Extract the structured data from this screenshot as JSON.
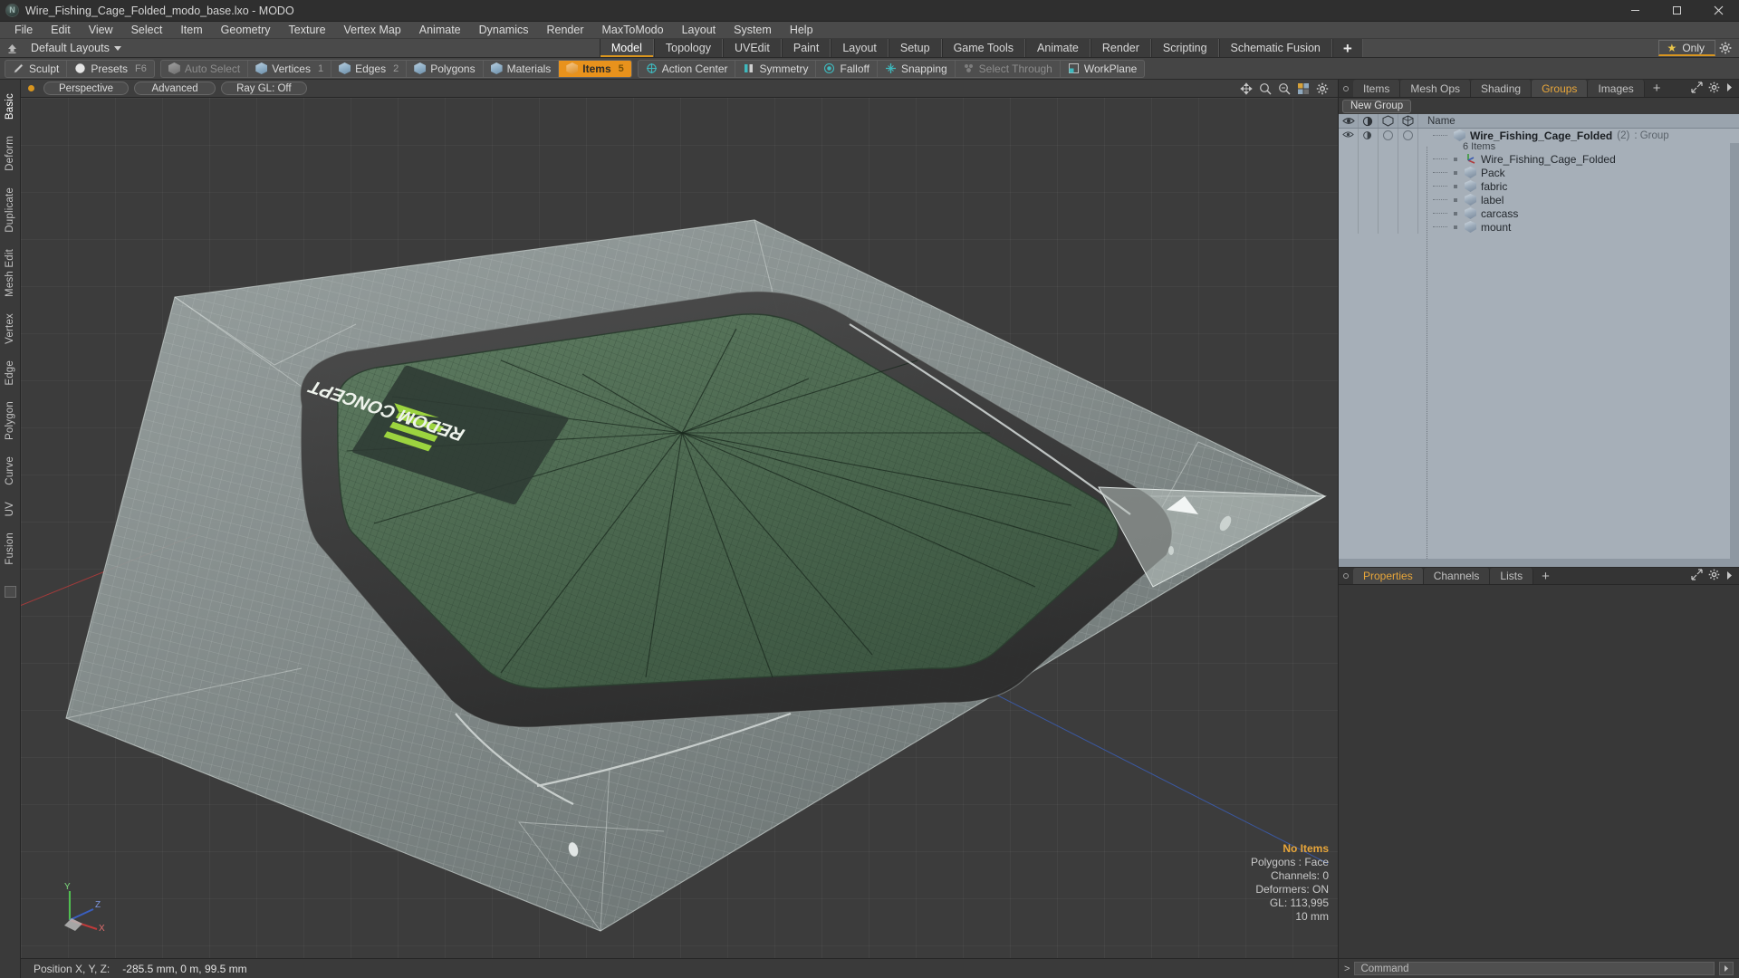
{
  "window": {
    "title": "Wire_Fishing_Cage_Folded_modo_base.lxo - MODO",
    "app_icon": "modo-logo-icon",
    "minimize": "minimize-icon",
    "maximize": "maximize-icon",
    "close": "close-icon"
  },
  "menubar": {
    "items": [
      "File",
      "Edit",
      "View",
      "Select",
      "Item",
      "Geometry",
      "Texture",
      "Vertex Map",
      "Animate",
      "Dynamics",
      "Render",
      "MaxToModo",
      "Layout",
      "System",
      "Help"
    ]
  },
  "layoutrow": {
    "home_icon": "home-icon",
    "layout_selector": "Default Layouts",
    "tabs": [
      {
        "label": "Model",
        "active": true
      },
      {
        "label": "Topology",
        "active": false
      },
      {
        "label": "UVEdit",
        "active": false
      },
      {
        "label": "Paint",
        "active": false
      },
      {
        "label": "Layout",
        "active": false
      },
      {
        "label": "Setup",
        "active": false
      },
      {
        "label": "Game Tools",
        "active": false
      },
      {
        "label": "Animate",
        "active": false
      },
      {
        "label": "Render",
        "active": false
      },
      {
        "label": "Scripting",
        "active": false
      },
      {
        "label": "Schematic Fusion",
        "active": false
      }
    ],
    "add_tab": "+",
    "only_button": "Only",
    "star_icon": "star-icon",
    "gear_icon": "gear-icon"
  },
  "modebar": {
    "group1": [
      {
        "label": "Sculpt",
        "icon": "pen-icon",
        "state": "normal",
        "badge": ""
      },
      {
        "label": "Presets",
        "icon": "sphere-icon",
        "state": "normal",
        "badge": "F6"
      }
    ],
    "group2": [
      {
        "label": "Auto Select",
        "icon": "cube-grey-icon",
        "state": "disabled",
        "badge": ""
      },
      {
        "label": "Vertices",
        "icon": "cube-icon",
        "state": "normal",
        "badge": "1"
      },
      {
        "label": "Edges",
        "icon": "cube-icon",
        "state": "normal",
        "badge": "2"
      },
      {
        "label": "Polygons",
        "icon": "cube-icon",
        "state": "normal",
        "badge": ""
      },
      {
        "label": "Materials",
        "icon": "cube-icon",
        "state": "normal",
        "badge": ""
      },
      {
        "label": "Items",
        "icon": "cube-orange-icon",
        "state": "selected",
        "badge": "5"
      }
    ],
    "group3": [
      {
        "label": "Action Center",
        "icon": "target-icon",
        "state": "normal",
        "badge": ""
      },
      {
        "label": "Symmetry",
        "icon": "symmetry-icon",
        "state": "normal",
        "badge": ""
      },
      {
        "label": "Falloff",
        "icon": "falloff-icon",
        "state": "normal",
        "badge": ""
      },
      {
        "label": "Snapping",
        "icon": "snap-icon",
        "state": "normal",
        "badge": ""
      },
      {
        "label": "Select Through",
        "icon": "select-through-icon",
        "state": "disabled",
        "badge": ""
      },
      {
        "label": "WorkPlane",
        "icon": "workplane-icon",
        "state": "normal",
        "badge": ""
      }
    ]
  },
  "left_strip": {
    "tabs": [
      "Basic",
      "Deform",
      "Duplicate",
      "Mesh Edit",
      "Vertex",
      "Edge",
      "Polygon",
      "Curve",
      "UV",
      "Fusion"
    ]
  },
  "viewport": {
    "header": {
      "dot": "active-dot-icon",
      "view_mode": "Perspective",
      "shading": "Advanced",
      "raygl": "Ray GL: Off",
      "icons": [
        "move-icon",
        "zoom-icon",
        "search-icon",
        "view-options-icon",
        "gear-icon"
      ]
    },
    "overlay": {
      "selection": "No Items",
      "polygons": "Polygons : Face",
      "channels": "Channels: 0",
      "deformers": "Deformers: ON",
      "gl": "GL: 113,995",
      "scale": "10 mm"
    },
    "gizmo_labels": {
      "y": "Y",
      "x": "X",
      "z": "Z"
    }
  },
  "statusbar": {
    "label": "Position X, Y, Z:",
    "value": "-285.5 mm, 0 m, 99.5 mm"
  },
  "right_panel": {
    "tabs": [
      {
        "label": "Items",
        "active": false
      },
      {
        "label": "Mesh Ops",
        "active": false
      },
      {
        "label": "Shading",
        "active": false
      },
      {
        "label": "Groups",
        "active": true
      },
      {
        "label": "Images",
        "active": false
      }
    ],
    "add_tab": "+",
    "expand_icon": "expand-icon",
    "gear_icon": "gear-icon",
    "arrow_icon": "chevron-right-icon",
    "new_group_button": "New Group",
    "tree_header": {
      "col_visible": "eye-icon",
      "col_render": "render-icon",
      "col_wire": "wireframe-icon",
      "col_shade": "shade-icon",
      "name": "Name"
    },
    "group": {
      "name": "Wire_Fishing_Cage_Folded",
      "count": "(2)",
      "type": ": Group",
      "subtitle": "6 Items",
      "icon": "group-shield-icon"
    },
    "items": [
      {
        "label": "Wire_Fishing_Cage_Folded",
        "icon": "locator-axis-icon"
      },
      {
        "label": "Pack",
        "icon": "mesh-shield-icon"
      },
      {
        "label": "fabric",
        "icon": "mesh-shield-icon"
      },
      {
        "label": "label",
        "icon": "mesh-shield-icon"
      },
      {
        "label": "carcass",
        "icon": "mesh-shield-icon"
      },
      {
        "label": "mount",
        "icon": "mesh-shield-icon"
      }
    ],
    "properties_tabs": [
      {
        "label": "Properties",
        "active": true
      },
      {
        "label": "Channels",
        "active": false
      },
      {
        "label": "Lists",
        "active": false
      }
    ],
    "properties_add": "+"
  },
  "command_bar": {
    "prompt": ">",
    "placeholder": "Command",
    "value": "",
    "run_icon": "chevron-right-icon"
  },
  "colors": {
    "accent_orange": "#e8951c",
    "panel_bg": "#3a3a3a",
    "tree_bg": "#a6afb8",
    "viewport_bg": "#3c3c3c",
    "axis_x": "#a33b3b",
    "axis_z": "#3b59a3",
    "mesh_green": "#4d6b51"
  }
}
